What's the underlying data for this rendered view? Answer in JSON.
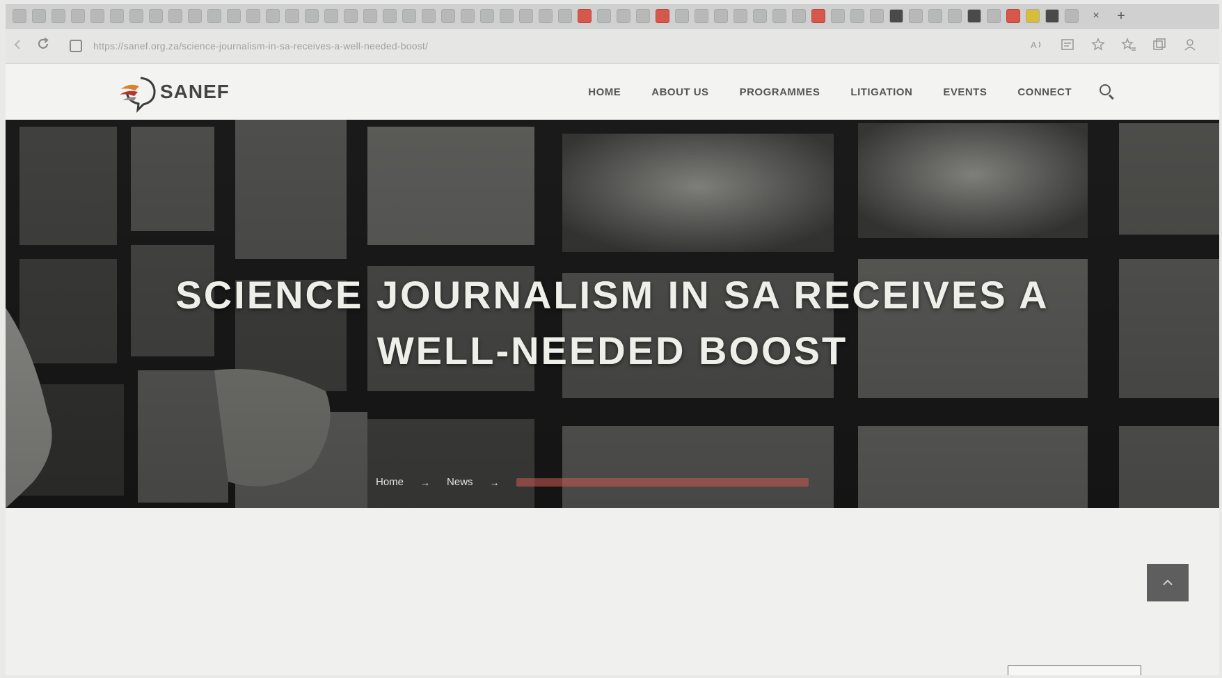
{
  "browser": {
    "url": "https://sanef.org.za/science-journalism-in-sa-receives-a-well-needed-boost/",
    "tab_close_glyph": "×",
    "new_tab_glyph": "+"
  },
  "site": {
    "logo_text": "SANEF",
    "nav": [
      "HOME",
      "ABOUT US",
      "PROGRAMMES",
      "LITIGATION",
      "EVENTS",
      "CONNECT"
    ]
  },
  "hero": {
    "title_line1": "SCIENCE JOURNALISM IN SA RECEIVES A",
    "title_line2": "WELL-NEEDED BOOST",
    "breadcrumb": {
      "home": "Home",
      "section": "News",
      "separator": "→"
    }
  },
  "colors": {
    "accent": "#c95a4e",
    "logo_orange": "#d9822b",
    "logo_red": "#b3372f",
    "text_dark": "#555555"
  },
  "icons": {
    "back": "arrow-left-icon",
    "reload": "reload-icon",
    "lock": "lock-icon",
    "search": "search-icon",
    "back_to_top": "chevron-up-icon"
  }
}
